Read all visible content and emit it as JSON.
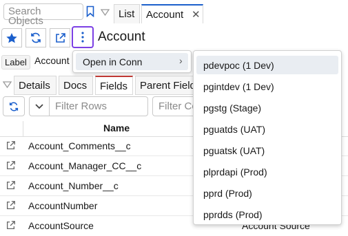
{
  "search": {
    "placeholder": "Search Objects"
  },
  "tabs": [
    {
      "label": "List"
    },
    {
      "label": "Account"
    }
  ],
  "header": {
    "title": "Account"
  },
  "info": {
    "label_tag": "Label",
    "label_value": "Account"
  },
  "subtabs": [
    {
      "label": "Details"
    },
    {
      "label": "Docs"
    },
    {
      "label": "Fields"
    },
    {
      "label": "Parent Fields"
    }
  ],
  "filters": {
    "rows_placeholder": "Filter Rows",
    "columns_placeholder": "Filter Columns"
  },
  "table": {
    "column_name": "Name",
    "rows": [
      {
        "name": "Account_Comments__c"
      },
      {
        "name": "Account_Manager_CC__c"
      },
      {
        "name": "Account_Number__c"
      },
      {
        "name": "AccountNumber"
      },
      {
        "name": "AccountSource",
        "label": "Account Source"
      }
    ]
  },
  "menu": {
    "open_in_conn": "Open in Conn",
    "connections": [
      "pdevpoc (1 Dev)",
      "pgintdev (1 Dev)",
      "pgstg (Stage)",
      "pguatds (UAT)",
      "pguatsk (UAT)",
      "plprdapi (Prod)",
      "pprd (Prod)",
      "pprdds (Prod)"
    ]
  },
  "colors": {
    "accent": "#1b5fcc",
    "kebab_border": "#7b3fe4",
    "active_subtab": "#c23934"
  }
}
